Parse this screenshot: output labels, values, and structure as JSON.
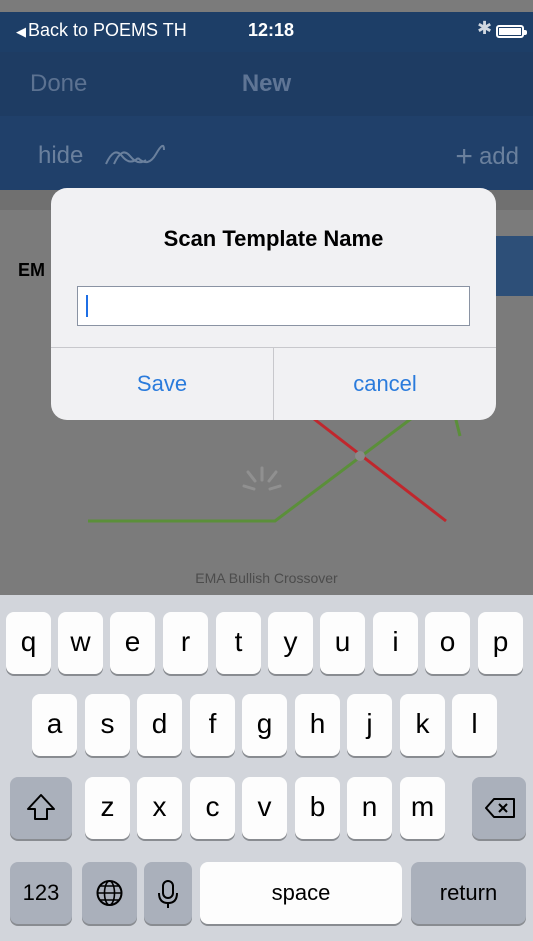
{
  "status_bar": {
    "back_label": "Back to POEMS TH",
    "time": "12:18"
  },
  "nav": {
    "done_label": "Done",
    "title": "New"
  },
  "toolbar": {
    "hide_label": "hide",
    "add_label": "add"
  },
  "content": {
    "em_label": "EM",
    "chart_caption": "EMA Bullish Crossover"
  },
  "dialog": {
    "title": "Scan Template Name",
    "input_value": "",
    "save_label": "Save",
    "cancel_label": "cancel"
  },
  "keyboard": {
    "row1": [
      "q",
      "w",
      "e",
      "r",
      "t",
      "y",
      "u",
      "i",
      "o",
      "p"
    ],
    "row2": [
      "a",
      "s",
      "d",
      "f",
      "g",
      "h",
      "j",
      "k",
      "l"
    ],
    "row3": [
      "z",
      "x",
      "c",
      "v",
      "b",
      "n",
      "m"
    ],
    "numbers_label": "123",
    "space_label": "space",
    "return_label": "return"
  },
  "colors": {
    "nav_bg": "#1e3c63",
    "accent_blue": "#2a7bdc",
    "chart_green": "#5b8f3a",
    "chart_red": "#c0272d"
  }
}
